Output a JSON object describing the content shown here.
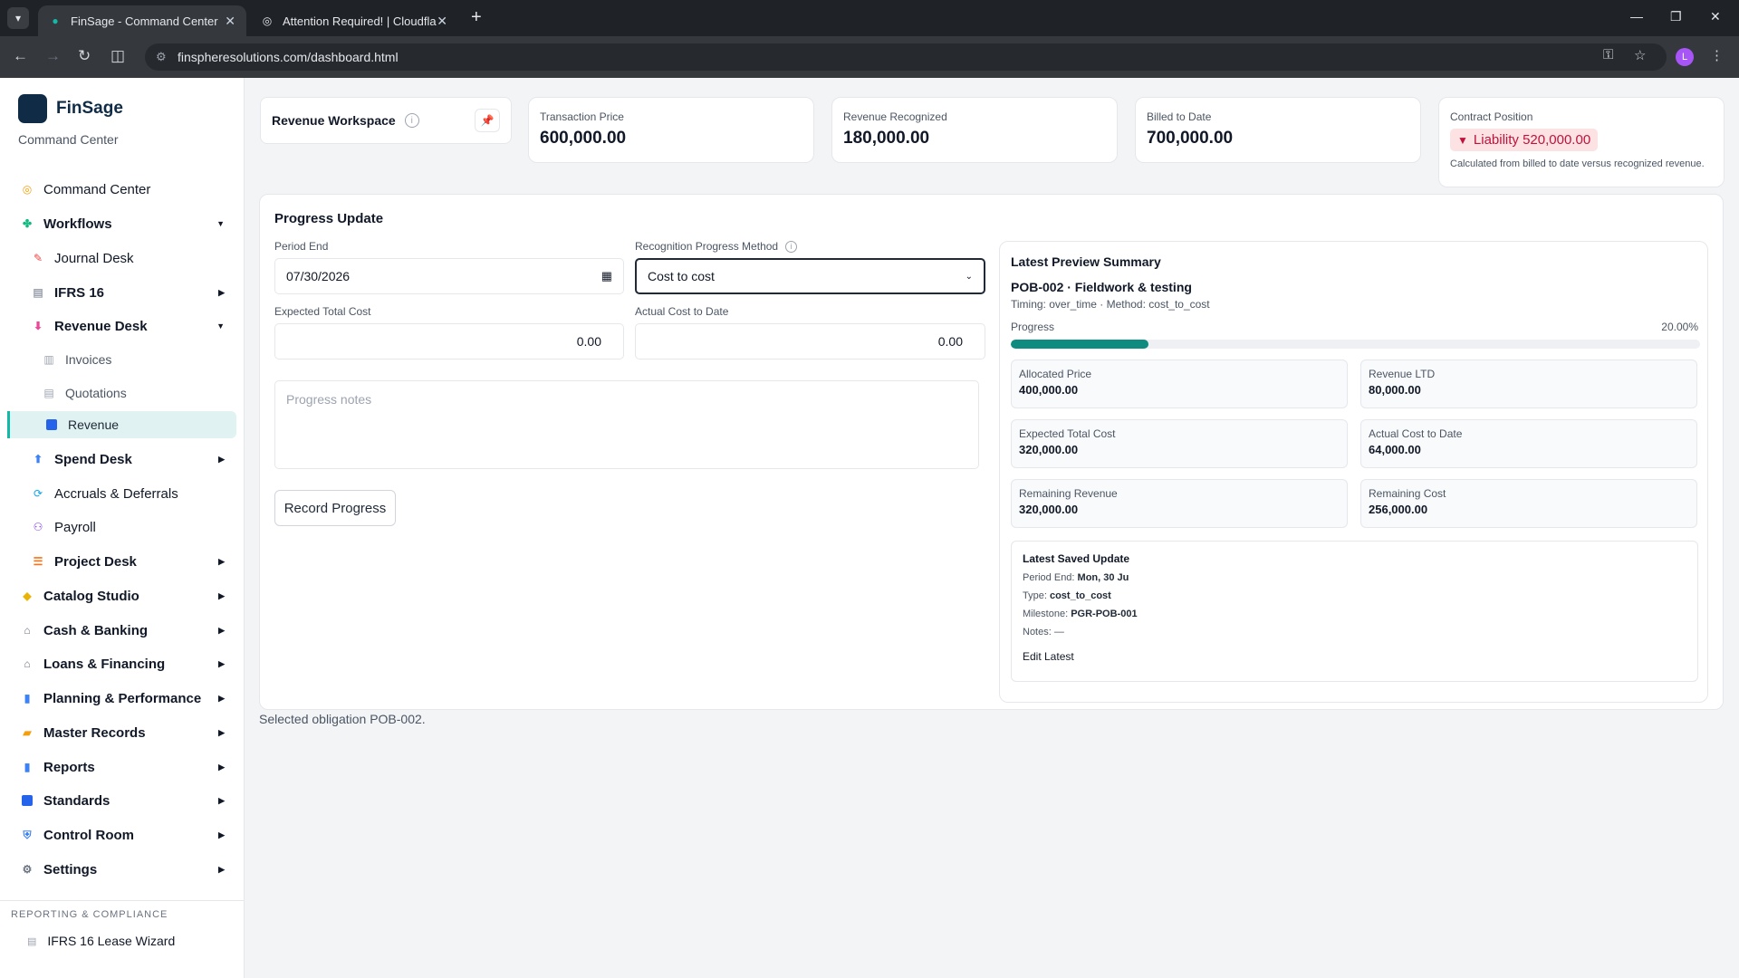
{
  "browser": {
    "tabs": [
      {
        "title": "FinSage - Command Center",
        "icon": "finsage-favicon"
      },
      {
        "title": "Attention Required! | Cloudflare",
        "icon": "globe-icon"
      }
    ],
    "url": "finspheresolutions.com/dashboard.html",
    "profile_initial": "L"
  },
  "sidebar": {
    "brand": "FinSage",
    "subtitle": "Command Center",
    "items": [
      {
        "label": "Command Center",
        "icon": "target-icon",
        "color": "#f59e0b"
      },
      {
        "label": "Workflows",
        "icon": "puzzle-icon",
        "color": "#10b981"
      },
      {
        "label": "Journal Desk",
        "icon": "document-icon",
        "color": "#ef4444"
      },
      {
        "label": "IFRS 16",
        "icon": "page-icon",
        "color": "#9ca3af"
      },
      {
        "label": "Revenue Desk",
        "icon": "inbox-icon",
        "color": "#ec4899"
      },
      {
        "label": "Invoices",
        "icon": "receipt-icon",
        "color": "#9ca3af"
      },
      {
        "label": "Quotations",
        "icon": "note-icon",
        "color": "#9ca3af"
      },
      {
        "label": "Revenue",
        "icon": "book-icon",
        "color": "#2563eb"
      },
      {
        "label": "Spend Desk",
        "icon": "outbox-icon",
        "color": "#3b82f6"
      },
      {
        "label": "Accruals & Deferrals",
        "icon": "cycle-icon",
        "color": "#0ea5e9"
      },
      {
        "label": "Payroll",
        "icon": "people-icon",
        "color": "#7c3aed"
      },
      {
        "label": "Project Desk",
        "icon": "gantt-icon",
        "color": "#f97316"
      },
      {
        "label": "Catalog Studio",
        "icon": "tag-icon",
        "color": "#eab308"
      },
      {
        "label": "Cash & Banking",
        "icon": "bank-icon",
        "color": "#6b7280"
      },
      {
        "label": "Loans & Financing",
        "icon": "bank-icon",
        "color": "#6b7280"
      },
      {
        "label": "Planning & Performance",
        "icon": "bar-chart-icon",
        "color": "#3b82f6"
      },
      {
        "label": "Master Records",
        "icon": "folder-icon",
        "color": "#f59e0b"
      },
      {
        "label": "Reports",
        "icon": "bar-chart-icon",
        "color": "#3b82f6"
      },
      {
        "label": "Standards",
        "icon": "book-icon",
        "color": "#2563eb"
      },
      {
        "label": "Control Room",
        "icon": "shield-icon",
        "color": "#3b82f6"
      },
      {
        "label": "Settings",
        "icon": "gear-icon",
        "color": "#6b7280"
      }
    ],
    "section_label": "REPORTING & COMPLIANCE",
    "footer_item": "IFRS 16 Lease Wizard"
  },
  "workspace": {
    "title": "Revenue Workspace"
  },
  "kpis": {
    "transaction_price": {
      "label": "Transaction Price",
      "value": "600,000.00"
    },
    "revenue_recognized": {
      "label": "Revenue Recognized",
      "value": "180,000.00"
    },
    "billed_to_date": {
      "label": "Billed to Date",
      "value": "700,000.00"
    },
    "contract_position": {
      "label": "Contract Position",
      "badge": "Liability 520,000.00",
      "note": "Calculated from billed to date versus recognized revenue.",
      "color": "#be123c"
    }
  },
  "progress": {
    "title": "Progress Update",
    "period_end_label": "Period End",
    "period_end_value": "07/30/2026",
    "method_label": "Recognition Progress Method",
    "method_value": "Cost to cost",
    "expected_label": "Expected Total Cost",
    "expected_value": "0.00",
    "actual_label": "Actual Cost to Date",
    "actual_value": "0.00",
    "notes_placeholder": "Progress notes",
    "record_button": "Record Progress"
  },
  "preview": {
    "title": "Latest Preview Summary",
    "obligation": "POB-002 · Fieldwork & testing",
    "meta": "Timing: over_time · Method: cost_to_cost",
    "progress_label": "Progress",
    "progress_pct_text": "20.00%",
    "progress_fraction": 0.2,
    "stats": [
      {
        "label": "Allocated Price",
        "value": "400,000.00"
      },
      {
        "label": "Revenue LTD",
        "value": "80,000.00"
      },
      {
        "label": "Expected Total Cost",
        "value": "320,000.00"
      },
      {
        "label": "Actual Cost to Date",
        "value": "64,000.00"
      },
      {
        "label": "Remaining Revenue",
        "value": "320,000.00"
      },
      {
        "label": "Remaining Cost",
        "value": "256,000.00"
      }
    ],
    "saved": {
      "title": "Latest Saved Update",
      "period_end_label": "Period End:",
      "period_end_value": "Mon, 30 Ju",
      "type_label": "Type:",
      "type_value": "cost_to_cost",
      "milestone_label": "Milestone:",
      "milestone_value": "PGR-POB-001",
      "notes_label": "Notes:",
      "notes_value": "—",
      "edit_label": "Edit Latest"
    }
  },
  "footer_note": "Selected obligation POB-002."
}
